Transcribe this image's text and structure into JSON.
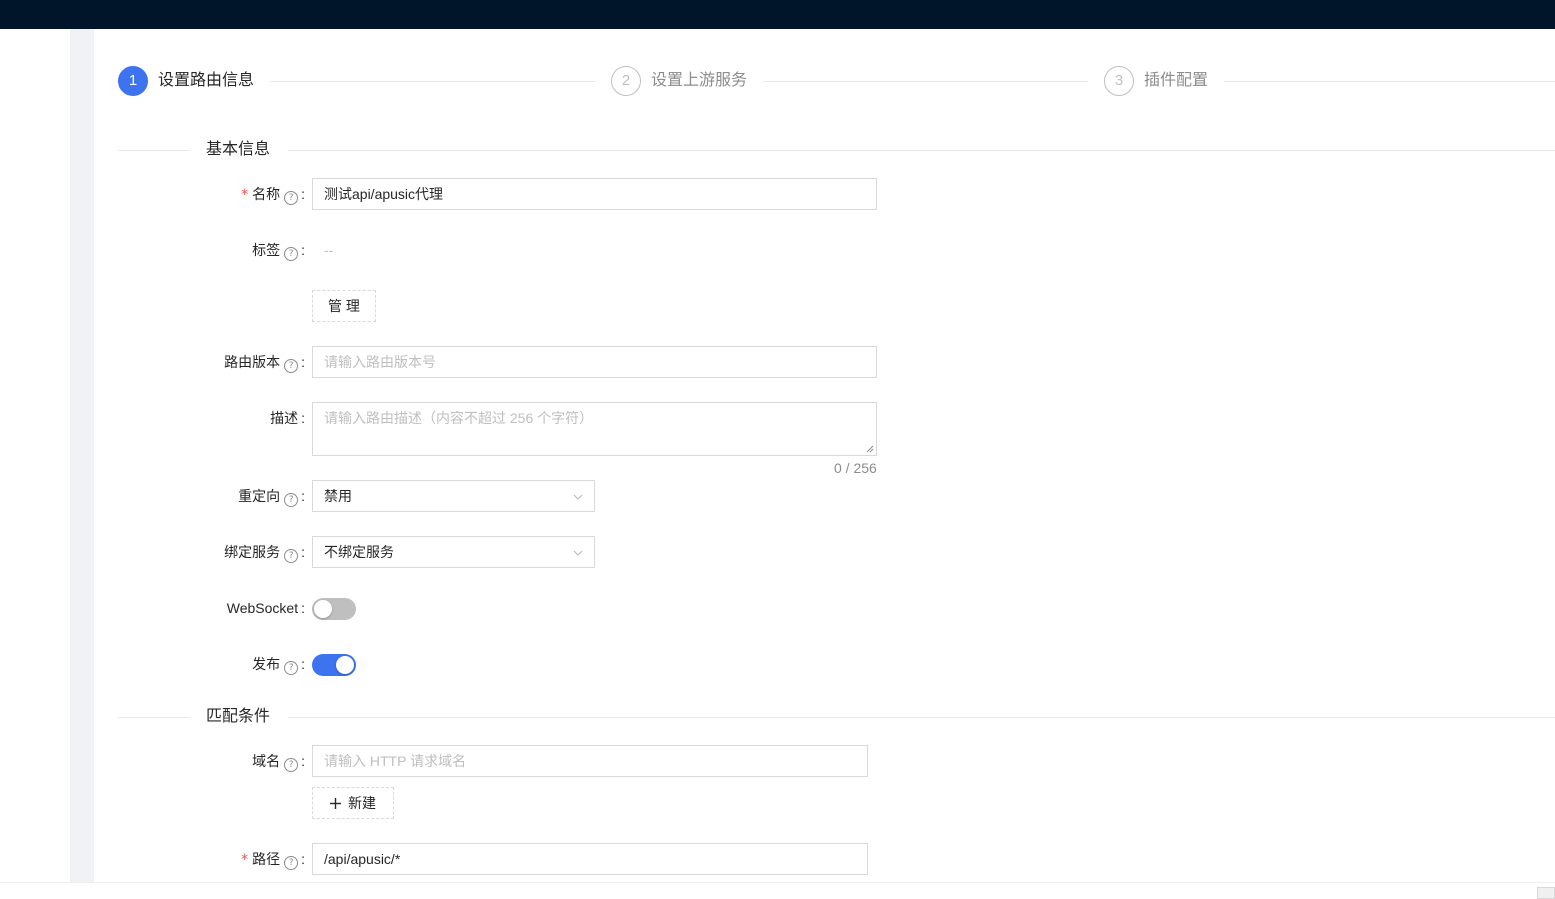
{
  "steps": [
    {
      "number": "1",
      "title": "设置路由信息",
      "status": "active"
    },
    {
      "number": "2",
      "title": "设置上游服务",
      "status": "wait"
    },
    {
      "number": "3",
      "title": "插件配置",
      "status": "wait"
    }
  ],
  "sections": {
    "basic": "基本信息",
    "match": "匹配条件"
  },
  "form": {
    "name": {
      "label": "名称",
      "value": "测试api/apusic代理",
      "required": true
    },
    "labels": {
      "label": "标签",
      "value": "--",
      "manage_button": "管 理"
    },
    "version": {
      "label": "路由版本",
      "placeholder": "请输入路由版本号"
    },
    "description": {
      "label": "描述",
      "placeholder": "请输入路由描述（内容不超过 256 个字符）",
      "counter": "0 / 256"
    },
    "redirect": {
      "label": "重定向",
      "value": "禁用"
    },
    "service": {
      "label": "绑定服务",
      "value": "不绑定服务"
    },
    "websocket": {
      "label": "WebSocket",
      "enabled": false
    },
    "publish": {
      "label": "发布",
      "enabled": true
    },
    "host": {
      "label": "域名",
      "placeholder": "请输入 HTTP 请求域名",
      "add_button": "新建"
    },
    "path": {
      "label": "路径",
      "value": "/api/apusic/*",
      "required": true
    }
  },
  "icons": {
    "help": "question-circle-icon",
    "chevron": "chevron-down-icon",
    "plus": "plus-icon"
  },
  "colors": {
    "primary": "#3e73f0",
    "header": "#001529",
    "required": "#ff4d4f"
  }
}
